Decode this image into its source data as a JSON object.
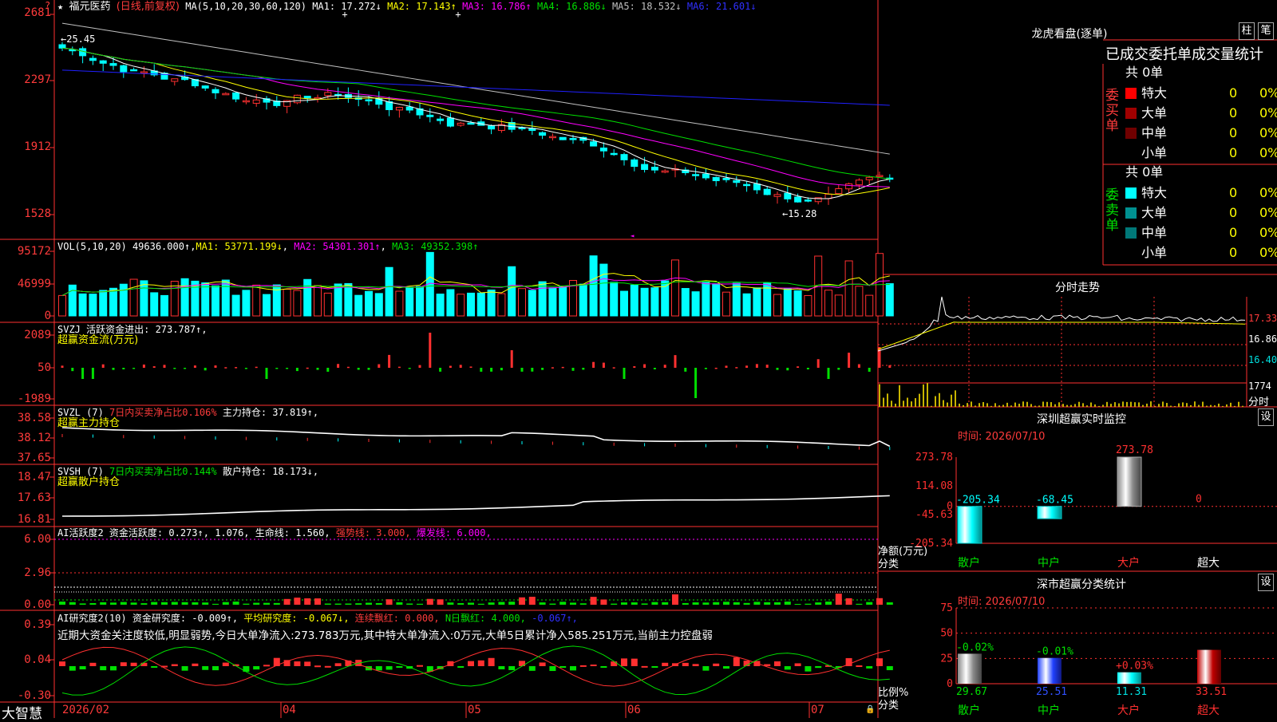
{
  "stock": {
    "name": "福元医药",
    "period": "(日线,前复权)",
    "ma_label": "MA(5,10,20,30,60,120)"
  },
  "price_legend": [
    {
      "label": "MA1: 17.272↓",
      "color": "#ffffff"
    },
    {
      "label": "MA2: 17.143↑",
      "color": "#ffff00"
    },
    {
      "label": "MA3: 16.786↑",
      "color": "#ff00ff"
    },
    {
      "label": "MA4: 16.886↓",
      "color": "#00e000"
    },
    {
      "label": "MA5: 18.532↓",
      "color": "#c0c0c0"
    },
    {
      "label": "MA6: 21.601↓",
      "color": "#3030ff"
    }
  ],
  "price_axis": [
    "2681",
    "2297",
    "1912",
    "1528"
  ],
  "price_annotations": {
    "high": "←25.45",
    "low": "←15.28"
  },
  "vol": {
    "title": "VOL(5,10,20)",
    "value": "49636.000↑",
    "ma1": "MA1: 53771.199↓",
    "ma2": "MA2: 54301.301↑",
    "ma3": "MA3: 49352.398↑",
    "axis": [
      "95172",
      "46999",
      "0"
    ]
  },
  "svzj": {
    "line1": "SVZJ  活跃资金进出: 273.787↑,",
    "line2": "超赢资金流(万元)",
    "axis": [
      "2089",
      "50",
      "-1989"
    ]
  },
  "svzl": {
    "line1a": "SVZL (7)",
    "line1b": "7日内买卖净占比0.106%",
    "line1c": "主力持仓: 37.819↑,",
    "line2": "超赢主力持仓",
    "axis": [
      "38.58",
      "38.12",
      "37.65"
    ]
  },
  "svsh": {
    "line1a": "SVSH (7)",
    "line1b": "7日内买卖净占比0.144%",
    "line1c": "散户持仓: 18.173↓,",
    "line2": "超赢散户持仓",
    "axis": [
      "18.47",
      "17.63",
      "16.81"
    ]
  },
  "ai1": {
    "a": "AI活跃度2",
    "b": "资金活跃度: 0.273↑,",
    "c": "1.076,",
    "d": "生命线: 1.560,",
    "e": "强势线: 3.000,",
    "f": "爆发线: 6.000,",
    "axis": [
      "6.00",
      "2.96",
      "0.00"
    ]
  },
  "ai2": {
    "a": "AI研究度2(10)",
    "b": "资金研究度: -0.009↑,",
    "c": "平均研究度: -0.067↓,",
    "d": "连续飘红: 0.000,",
    "e": "N日飘红: 4.000,",
    "f": "-0.067↑,",
    "note": "近期大资金关注度较低,明显弱势,今日大单净流入:273.783万元,其中特大单净流入:0万元,大单5日累计净入585.251万元,当前主力控盘弱",
    "axis": [
      "0.39",
      "0.04",
      "-0.30"
    ]
  },
  "bottom": {
    "brand": "大智慧",
    "dates": [
      "2026/02",
      "04",
      "05",
      "06",
      "07"
    ]
  },
  "lhb": {
    "title": "龙虎看盘(逐单)",
    "btn1": "柱",
    "btn2": "笔",
    "tabs": [
      "已成交",
      "委托单",
      "成交量统计"
    ],
    "buy": {
      "side": "委买单",
      "total": "共 0单",
      "rows": [
        {
          "name": "特大",
          "val": "0",
          "pct": "0%",
          "color": "#ff0000"
        },
        {
          "name": "大单",
          "val": "0",
          "pct": "0%",
          "color": "#a00000"
        },
        {
          "name": "中单",
          "val": "0",
          "pct": "0%",
          "color": "#700000"
        },
        {
          "name": "小单",
          "val": "0",
          "pct": "0%",
          "color": "#000000"
        }
      ]
    },
    "sell": {
      "side": "委卖单",
      "total": "共 0单",
      "rows": [
        {
          "name": "特大",
          "val": "0",
          "pct": "0%",
          "color": "#00ffff"
        },
        {
          "name": "大单",
          "val": "0",
          "pct": "0%",
          "color": "#009090"
        },
        {
          "name": "中单",
          "val": "0",
          "pct": "0%",
          "color": "#007878"
        },
        {
          "name": "小单",
          "val": "0",
          "pct": "0%",
          "color": "#000000"
        }
      ]
    }
  },
  "fenshi": {
    "title": "分时走势",
    "axis": [
      "17.33",
      "16.86",
      "16.40",
      "1774",
      "分时"
    ]
  },
  "szjk": {
    "title": "深圳超赢实时监控",
    "btn": "设",
    "time": "时间: 2026/07/10",
    "axis": [
      "273.78",
      "114.08",
      "0",
      "-45.63",
      "-205.34"
    ],
    "ylabel": "净额(万元)",
    "xlabel": "分类",
    "cats": [
      "散户",
      "中户",
      "大户",
      "超大"
    ],
    "values": [
      "-205.34",
      "-68.45",
      "273.78",
      "0"
    ]
  },
  "szfl": {
    "title": "深市超赢分类统计",
    "btn": "设",
    "time": "时间: 2026/07/10",
    "axis": [
      "75",
      "50",
      "25",
      "0"
    ],
    "ylabel": "比例%",
    "xlabel": "分类",
    "cats": [
      "散户",
      "中户",
      "大户",
      "超大"
    ],
    "pcts": [
      "-0.02%",
      "-0.01%",
      "+0.03%",
      ""
    ],
    "values": [
      "29.67",
      "25.51",
      "11.31",
      "33.51"
    ]
  },
  "chart_data": [
    {
      "type": "bar",
      "title": "深圳超赢实时监控",
      "ylabel": "净额(万元)",
      "xlabel": "分类",
      "categories": [
        "散户",
        "中户",
        "大户",
        "超大"
      ],
      "values": [
        -205.34,
        -68.45,
        273.78,
        0
      ],
      "ylim": [
        -205.34,
        273.78
      ]
    },
    {
      "type": "bar",
      "title": "深市超赢分类统计",
      "ylabel": "比例%",
      "xlabel": "分类",
      "categories": [
        "散户",
        "中户",
        "大户",
        "超大"
      ],
      "values": [
        29.67,
        25.51,
        11.31,
        33.51
      ],
      "ylim": [
        0,
        75
      ]
    }
  ]
}
